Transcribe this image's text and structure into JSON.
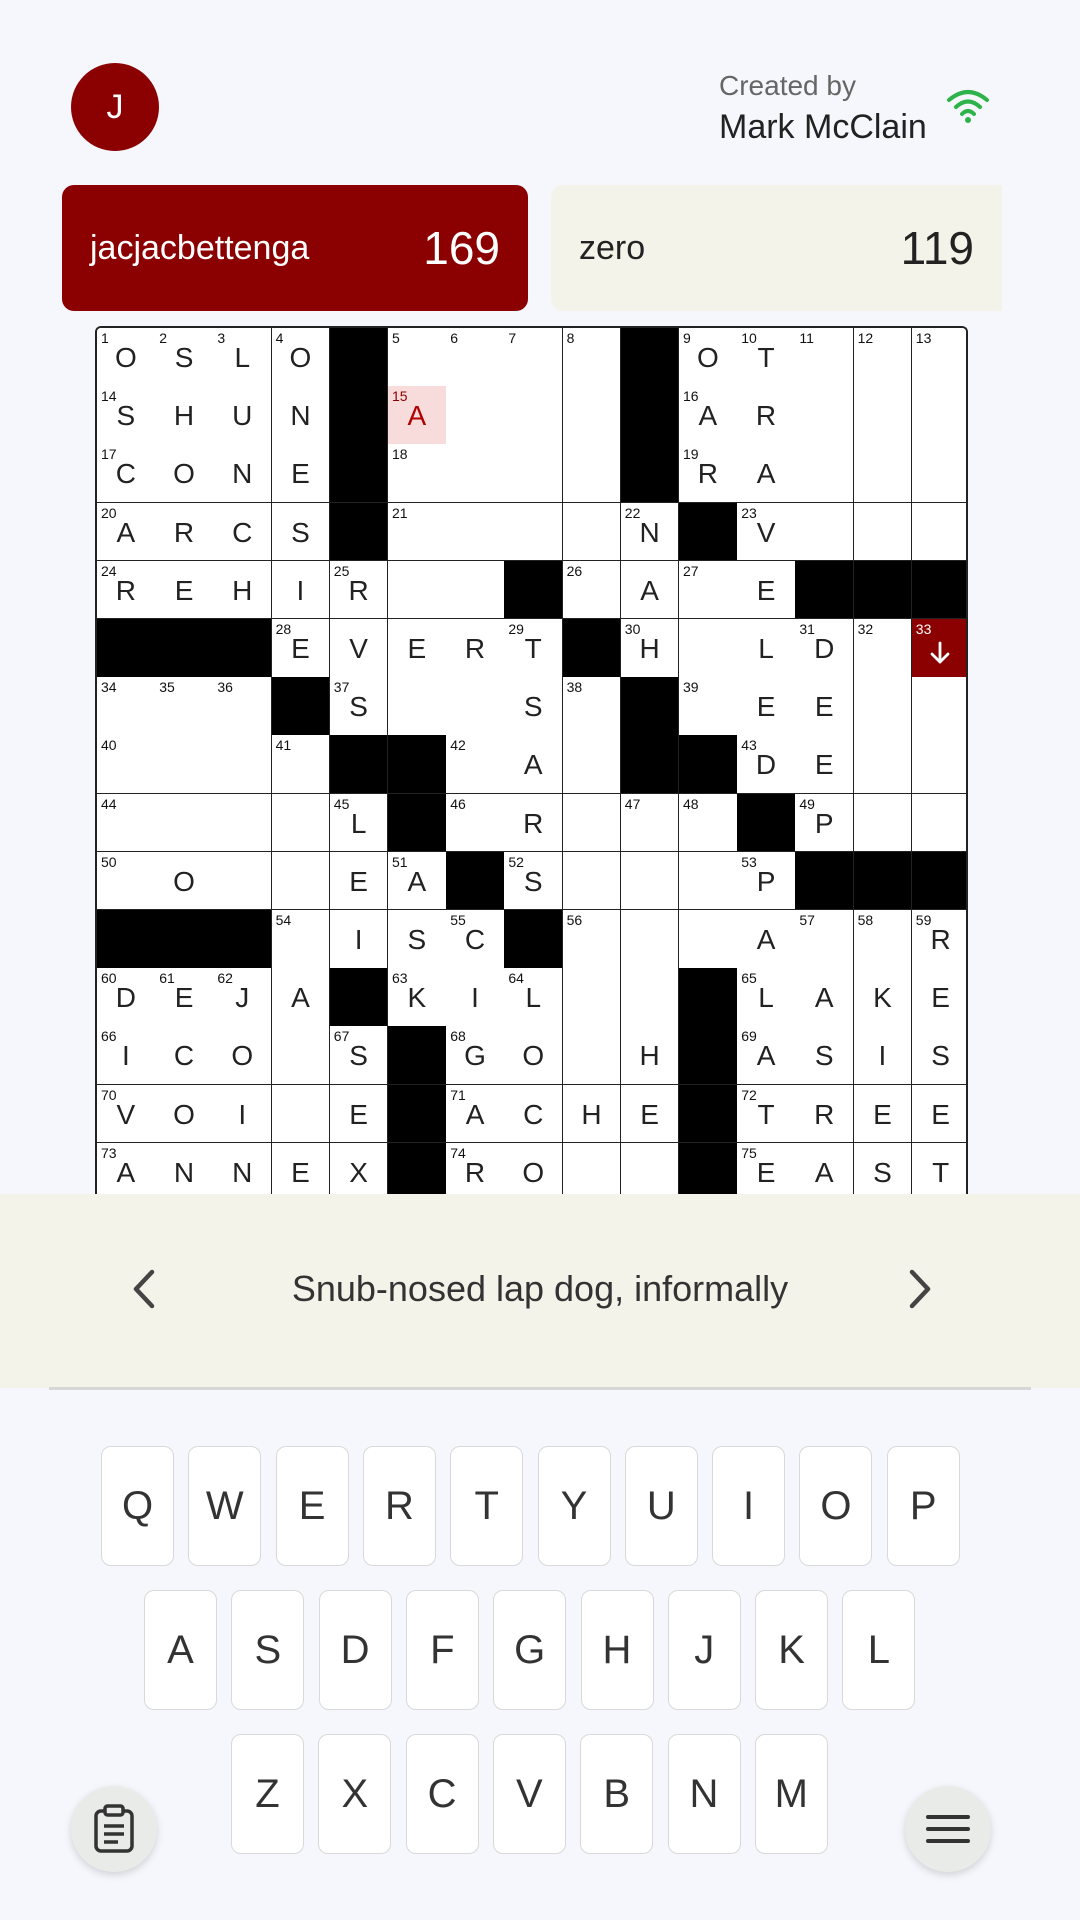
{
  "header": {
    "avatar_initial": "J",
    "created_by_label": "Created by",
    "creator_name": "Mark McClain",
    "status_icon": "wifi-icon",
    "status_color": "#2db34a"
  },
  "scores": [
    {
      "name": "jacjacbettenga",
      "score": "169"
    },
    {
      "name": "zero",
      "score": "119"
    }
  ],
  "colors": {
    "accent": "#8b0000",
    "highlight": "#f8dcdc",
    "clue_bar": "#f3f3e9"
  },
  "grid": {
    "cols": 15,
    "visible_rows": 15,
    "cursor": {
      "row": 5,
      "col": 14,
      "direction": "down"
    },
    "rows": [
      [
        [
          "1",
          "O"
        ],
        [
          "2",
          "S"
        ],
        [
          "3",
          "L"
        ],
        [
          "4",
          "O"
        ],
        "#",
        [
          "5",
          ""
        ],
        [
          "6",
          ""
        ],
        [
          "7",
          ""
        ],
        [
          "8",
          ""
        ],
        "#",
        [
          "9",
          "O"
        ],
        [
          "10",
          "T"
        ],
        [
          "11",
          ""
        ],
        [
          "12",
          ""
        ],
        [
          "13",
          ""
        ]
      ],
      [
        [
          "14",
          "S"
        ],
        [
          "",
          "H"
        ],
        [
          "",
          "U"
        ],
        [
          "",
          "N"
        ],
        "#",
        [
          "15",
          "A",
          "hl"
        ],
        [
          "",
          ""
        ],
        [
          "",
          ""
        ],
        [
          "",
          ""
        ],
        "#",
        [
          "16",
          "A"
        ],
        [
          "",
          "R"
        ],
        [
          "",
          ""
        ],
        [
          "",
          ""
        ],
        [
          "",
          ""
        ]
      ],
      [
        [
          "17",
          "C"
        ],
        [
          "",
          "O"
        ],
        [
          "",
          "N"
        ],
        [
          "",
          "E"
        ],
        "#",
        [
          "18",
          ""
        ],
        [
          "",
          ""
        ],
        [
          "",
          ""
        ],
        [
          "",
          ""
        ],
        "#",
        [
          "19",
          "R"
        ],
        [
          "",
          "A"
        ],
        [
          "",
          ""
        ],
        [
          "",
          ""
        ],
        [
          "",
          ""
        ]
      ],
      [
        [
          "20",
          "A"
        ],
        [
          "",
          "R"
        ],
        [
          "",
          "C"
        ],
        [
          "",
          "S"
        ],
        "#",
        [
          "21",
          ""
        ],
        [
          "",
          ""
        ],
        [
          "",
          ""
        ],
        [
          "",
          ""
        ],
        [
          "22",
          "N"
        ],
        "#",
        [
          "23",
          "V"
        ],
        [
          "",
          ""
        ],
        [
          "",
          ""
        ],
        [
          "",
          ""
        ]
      ],
      [
        [
          "24",
          "R"
        ],
        [
          "",
          "E"
        ],
        [
          "",
          "H"
        ],
        [
          "",
          "I"
        ],
        [
          "25",
          "R"
        ],
        [
          "",
          ""
        ],
        [
          "",
          ""
        ],
        "#",
        [
          "26",
          ""
        ],
        [
          "",
          "A"
        ],
        [
          "27",
          ""
        ],
        [
          "",
          "E"
        ],
        "#",
        "#",
        "#"
      ],
      [
        "#",
        "#",
        "#",
        [
          "28",
          "E"
        ],
        [
          "",
          "V"
        ],
        [
          "",
          "E"
        ],
        [
          "",
          "R"
        ],
        [
          "29",
          "T"
        ],
        "#",
        [
          "30",
          "H"
        ],
        [
          "",
          ""
        ],
        [
          "",
          "L"
        ],
        [
          "31",
          "D"
        ],
        [
          "32",
          ""
        ],
        [
          "33",
          "",
          "cur"
        ]
      ],
      [
        [
          "34",
          ""
        ],
        [
          "35",
          ""
        ],
        [
          "36",
          ""
        ],
        "#",
        [
          "37",
          "S"
        ],
        [
          "",
          ""
        ],
        [
          "",
          ""
        ],
        [
          "",
          "S"
        ],
        [
          "38",
          ""
        ],
        "#",
        [
          "39",
          ""
        ],
        [
          "",
          "E"
        ],
        [
          "",
          "E"
        ],
        [
          "",
          ""
        ],
        [
          "",
          ""
        ]
      ],
      [
        [
          "40",
          ""
        ],
        [
          "",
          ""
        ],
        [
          "",
          ""
        ],
        [
          "41",
          ""
        ],
        "#",
        "#",
        [
          "42",
          ""
        ],
        [
          "",
          "A"
        ],
        [
          "",
          ""
        ],
        "#",
        "#",
        [
          "43",
          "D"
        ],
        [
          "",
          "E"
        ],
        [
          "",
          ""
        ],
        [
          "",
          ""
        ]
      ],
      [
        [
          "44",
          ""
        ],
        [
          "",
          ""
        ],
        [
          "",
          ""
        ],
        [
          "",
          ""
        ],
        [
          "45",
          "L"
        ],
        "#",
        [
          "46",
          ""
        ],
        [
          "",
          "R"
        ],
        [
          "",
          ""
        ],
        [
          "47",
          ""
        ],
        [
          "48",
          ""
        ],
        "#",
        [
          "49",
          "P"
        ],
        [
          "",
          ""
        ],
        [
          "",
          ""
        ]
      ],
      [
        [
          "50",
          ""
        ],
        [
          "",
          "O"
        ],
        [
          "",
          ""
        ],
        [
          "",
          ""
        ],
        [
          "",
          "E"
        ],
        [
          "51",
          "A"
        ],
        "#",
        [
          "52",
          "S"
        ],
        [
          "",
          ""
        ],
        [
          "",
          ""
        ],
        [
          "",
          ""
        ],
        [
          "53",
          "P"
        ],
        "#",
        "#",
        "#"
      ],
      [
        "#",
        "#",
        "#",
        [
          "54",
          ""
        ],
        [
          "",
          "I"
        ],
        [
          "",
          "S"
        ],
        [
          "55",
          "C"
        ],
        "#",
        [
          "56",
          ""
        ],
        [
          "",
          ""
        ],
        [
          "",
          ""
        ],
        [
          "",
          "A"
        ],
        [
          "57",
          ""
        ],
        [
          "58",
          ""
        ],
        [
          "59",
          "R"
        ]
      ],
      [
        [
          "60",
          "D"
        ],
        [
          "61",
          "E"
        ],
        [
          "62",
          "J"
        ],
        [
          "",
          "A"
        ],
        "#",
        [
          "63",
          "K"
        ],
        [
          "",
          "I"
        ],
        [
          "64",
          "L"
        ],
        [
          "",
          ""
        ],
        [
          "",
          ""
        ],
        "#",
        [
          "65",
          "L"
        ],
        [
          "",
          "A"
        ],
        [
          "",
          "K"
        ],
        [
          "",
          "E"
        ]
      ],
      [
        [
          "66",
          "I"
        ],
        [
          "",
          "C"
        ],
        [
          "",
          "O"
        ],
        [
          "",
          ""
        ],
        [
          "67",
          "S"
        ],
        "#",
        [
          "68",
          "G"
        ],
        [
          "",
          "O"
        ],
        [
          "",
          ""
        ],
        [
          "",
          "H"
        ],
        "#",
        [
          "69",
          "A"
        ],
        [
          "",
          "S"
        ],
        [
          "",
          "I"
        ],
        [
          "",
          "S"
        ]
      ],
      [
        [
          "70",
          "V"
        ],
        [
          "",
          "O"
        ],
        [
          "",
          "I"
        ],
        [
          "",
          ""
        ],
        [
          "",
          "E"
        ],
        "#",
        [
          "71",
          "A"
        ],
        [
          "",
          "C"
        ],
        [
          "",
          "H"
        ],
        [
          "",
          "E"
        ],
        "#",
        [
          "72",
          "T"
        ],
        [
          "",
          "R"
        ],
        [
          "",
          "E"
        ],
        [
          "",
          "E"
        ]
      ],
      [
        [
          "73",
          "A"
        ],
        [
          "",
          "N"
        ],
        [
          "",
          "N"
        ],
        [
          "",
          "E"
        ],
        [
          "",
          "X"
        ],
        "#",
        [
          "74",
          "R"
        ],
        [
          "",
          "O"
        ],
        [
          "",
          ""
        ],
        [
          "",
          ""
        ],
        "#",
        [
          "75",
          "E"
        ],
        [
          "",
          "A"
        ],
        [
          "",
          "S"
        ],
        [
          "",
          "T"
        ]
      ]
    ]
  },
  "clue": {
    "text": "Snub-nosed lap dog, informally",
    "prev_icon": "chevron-left-icon",
    "next_icon": "chevron-right-icon"
  },
  "keyboard": {
    "rows": [
      [
        "Q",
        "W",
        "E",
        "R",
        "T",
        "Y",
        "U",
        "I",
        "O",
        "P"
      ],
      [
        "A",
        "S",
        "D",
        "F",
        "G",
        "H",
        "J",
        "K",
        "L"
      ],
      [
        "Z",
        "X",
        "C",
        "V",
        "B",
        "N",
        "M"
      ]
    ]
  },
  "fabs": {
    "left_icon": "clipboard-icon",
    "right_icon": "menu-icon"
  }
}
